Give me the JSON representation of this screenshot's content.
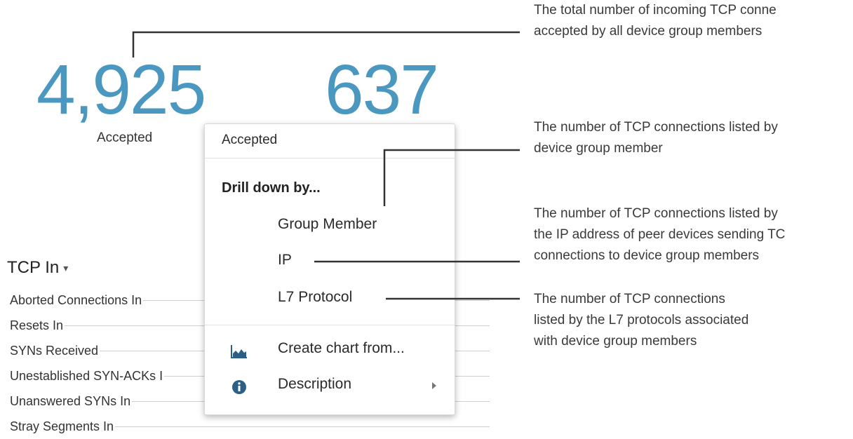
{
  "metrics": {
    "accepted_value": "4,925",
    "accepted_label": "Accepted",
    "second_value": "637"
  },
  "section": {
    "title": "TCP In",
    "rows": [
      "Aborted Connections In",
      "Resets In",
      "SYNs Received",
      "Unestablished SYN-ACKs I",
      "Unanswered SYNs In",
      "Stray Segments In"
    ]
  },
  "menu": {
    "header": "Accepted",
    "drill_heading": "Drill down by...",
    "drill_items": [
      "Group Member",
      "IP",
      "L7 Protocol"
    ],
    "actions": {
      "create_chart": "Create chart from...",
      "description": "Description"
    },
    "icons": {
      "create_chart": "area-chart-icon",
      "description": "info-circle-icon",
      "submenu": "chevron-right-icon",
      "section_dropdown": "caret-down-icon"
    }
  },
  "callouts": {
    "c1": [
      "The total number of incoming TCP conne",
      "accepted by all device group members"
    ],
    "c2": [
      "The number of TCP connections listed by",
      "device group member"
    ],
    "c3": [
      "The number of TCP connections listed by",
      "the IP address of peer devices sending TC",
      "connections to device group members"
    ],
    "c4": [
      "The number of TCP connections",
      "listed by the L7 protocols associated",
      "with device group members"
    ]
  },
  "colors": {
    "metric_value": "#4a98c0",
    "icon": "#2d5f86",
    "leader_line": "#333333"
  }
}
